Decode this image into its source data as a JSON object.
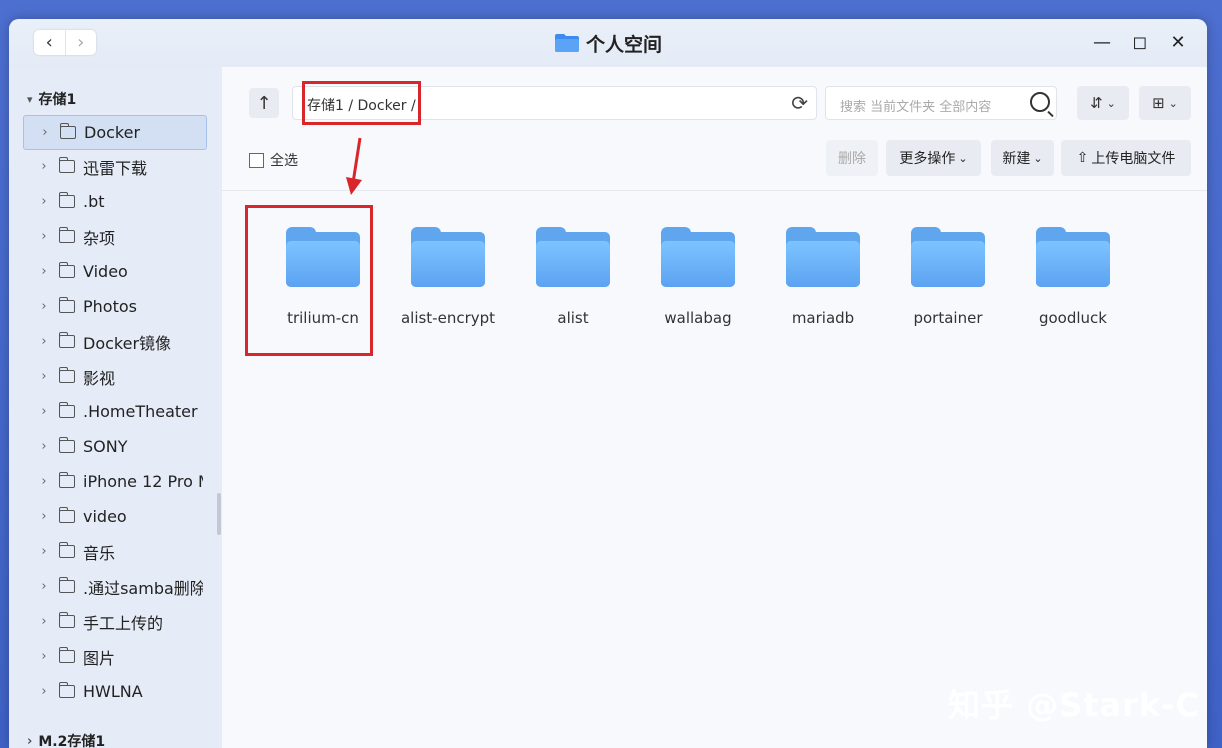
{
  "window": {
    "title": "个人空间",
    "nav": {
      "back": "‹",
      "forward": "›"
    },
    "controls": {
      "minimize": "—",
      "maximize": "◻",
      "close": "✕"
    }
  },
  "sidebar": {
    "groups": [
      {
        "label": "存储1",
        "expanded": true
      },
      {
        "label": "M.2存储1",
        "expanded": false
      }
    ],
    "items": [
      {
        "label": "Docker",
        "active": true
      },
      {
        "label": "迅雷下载"
      },
      {
        "label": ".bt"
      },
      {
        "label": "杂项"
      },
      {
        "label": "Video"
      },
      {
        "label": "Photos"
      },
      {
        "label": "Docker镜像"
      },
      {
        "label": "影视"
      },
      {
        "label": ".HomeTheater"
      },
      {
        "label": "SONY"
      },
      {
        "label": "iPhone 12 Pro M"
      },
      {
        "label": "video"
      },
      {
        "label": "音乐"
      },
      {
        "label": ".通过samba删除"
      },
      {
        "label": "手工上传的"
      },
      {
        "label": "图片"
      },
      {
        "label": "HWLNA"
      }
    ]
  },
  "toolbar": {
    "path": "存储1 / Docker /",
    "search_placeholder": "搜索 当前文件夹 全部内容",
    "select_all": "全选",
    "delete": "删除",
    "more_actions": "更多操作",
    "new": "新建",
    "upload": "上传电脑文件"
  },
  "folders": [
    "trilium-cn",
    "alist-encrypt",
    "alist",
    "wallabag",
    "mariadb",
    "portainer",
    "goodluck"
  ],
  "watermark": "知乎 @Stark-C",
  "colors": {
    "highlight": "#d8262b",
    "folder": "#5fa6ee",
    "accent": "#a8c1ea"
  }
}
